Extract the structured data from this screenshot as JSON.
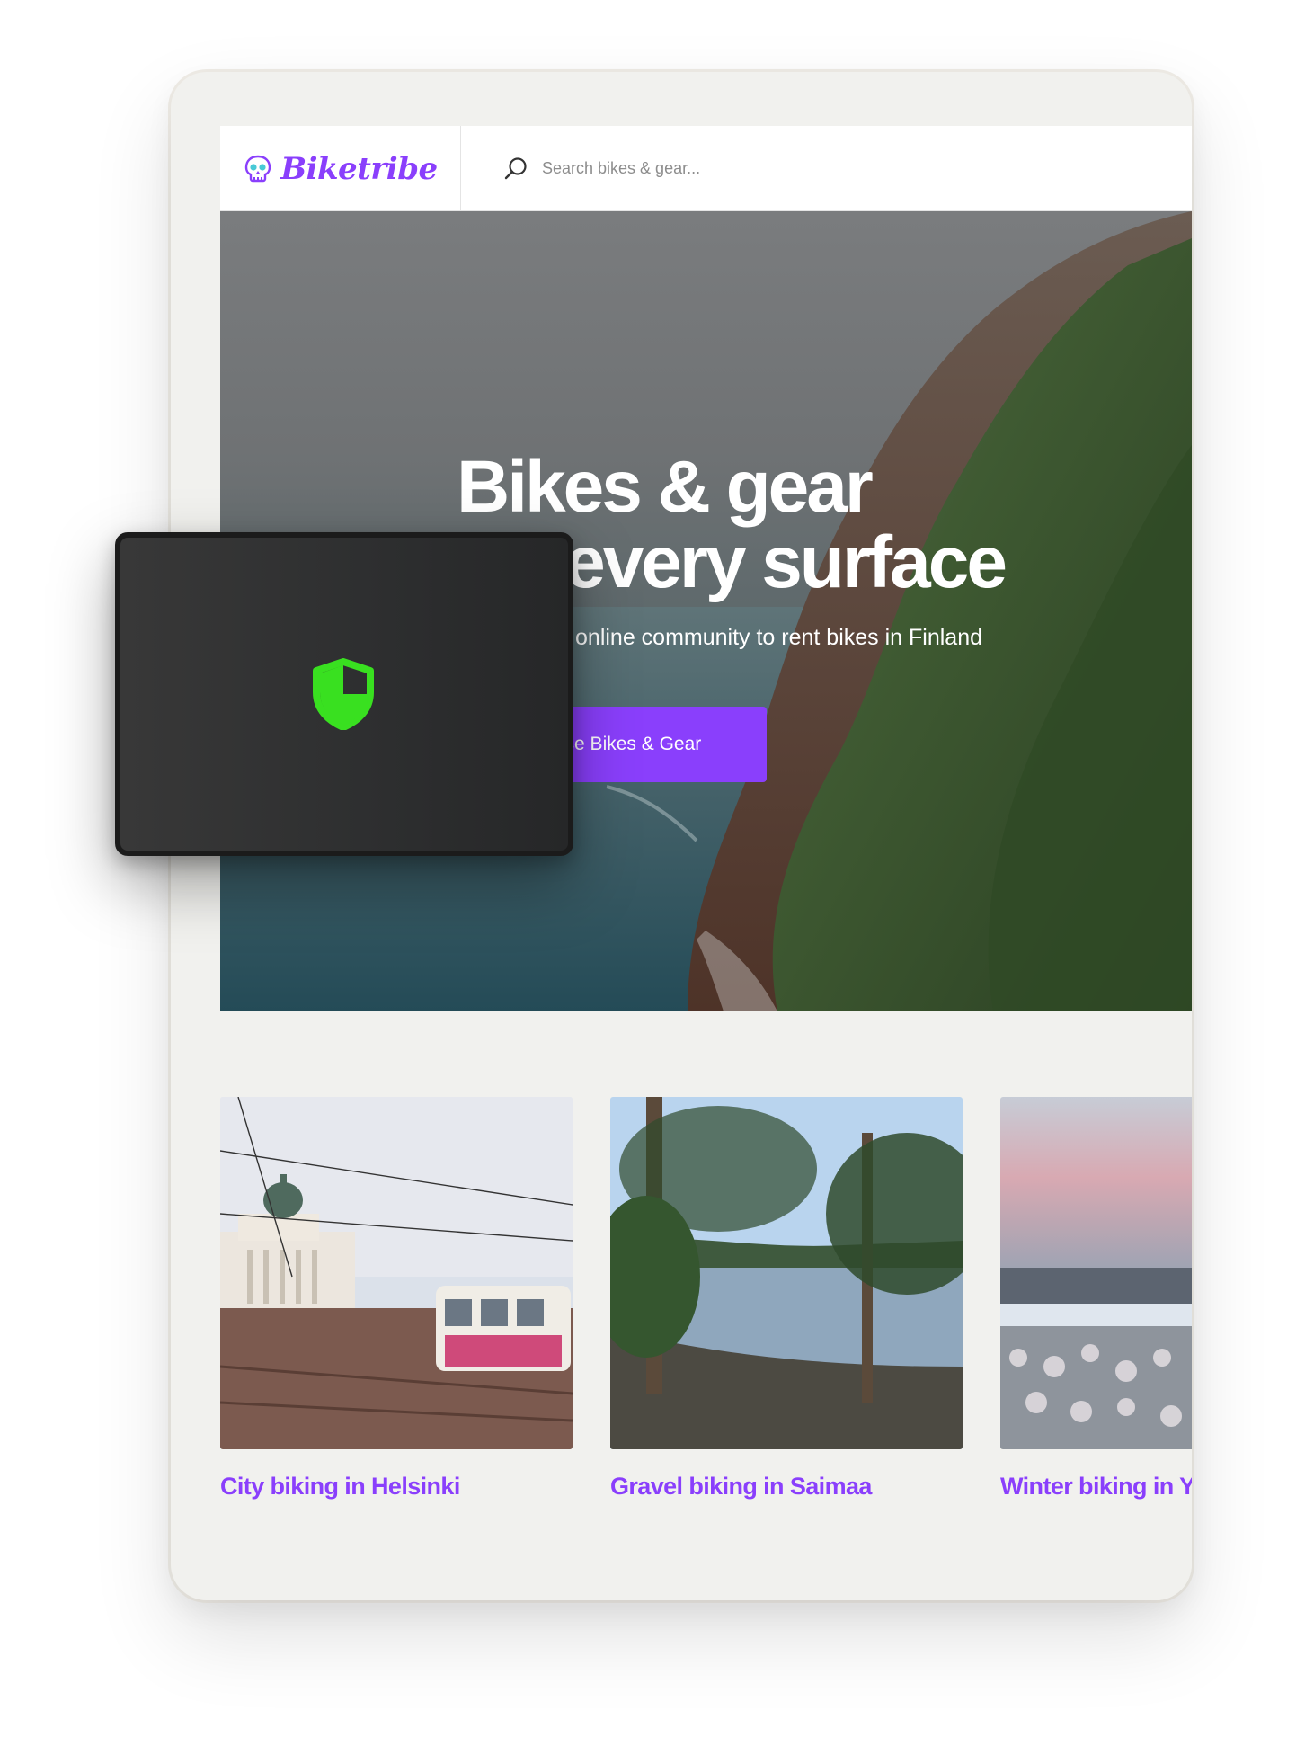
{
  "app": {
    "brand_name": "Biketribe",
    "accent_color": "#8a3ffc",
    "logo_icon": "skull-icon"
  },
  "header": {
    "search_placeholder": "Search bikes & gear...",
    "search_icon": "search-icon"
  },
  "hero": {
    "title_line1": "Bikes & gear",
    "title_line2": "for every surface",
    "subtitle": "The largest online community to rent bikes in Finland",
    "cta_label": "Browse Bikes & Gear"
  },
  "cards": [
    {
      "title": "City biking in Helsinki"
    },
    {
      "title": "Gravel biking in Saimaa"
    },
    {
      "title": "Winter biking in Ylläs"
    }
  ],
  "overlay": {
    "icon": "shield-icon",
    "icon_color": "#39e020"
  }
}
